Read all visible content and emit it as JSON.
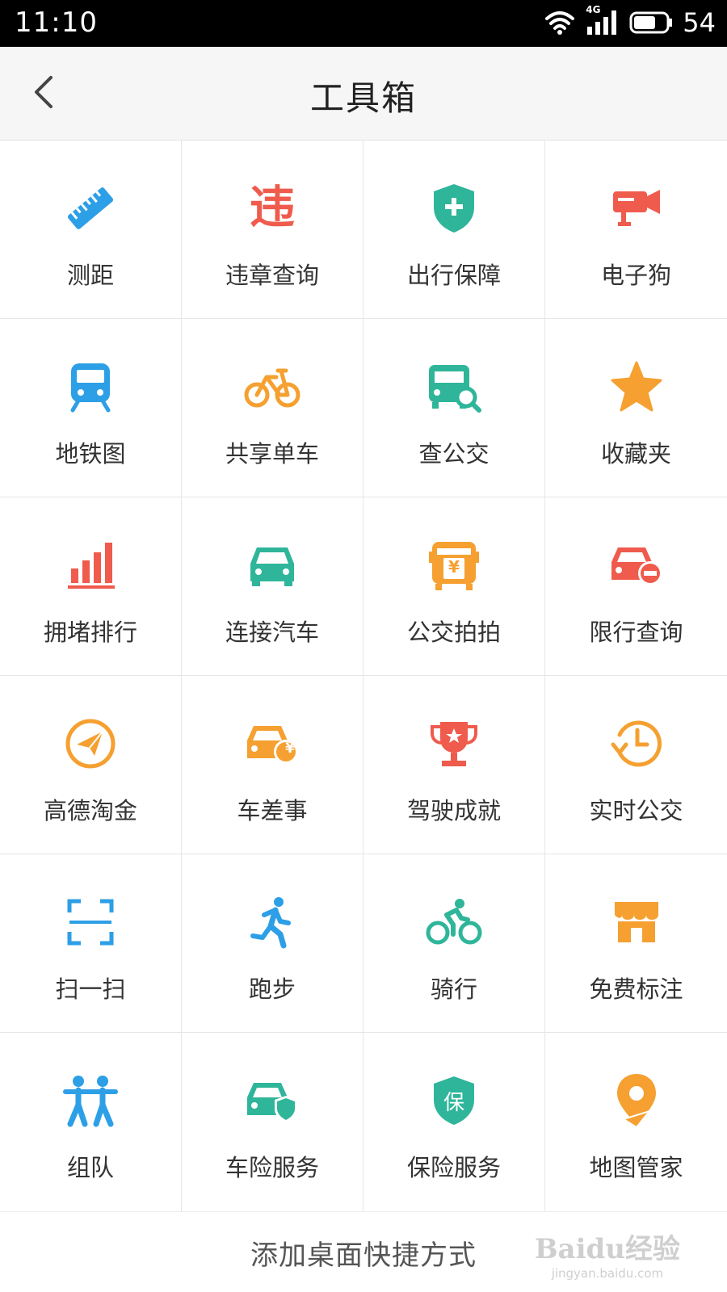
{
  "status_bar": {
    "time": "11:10",
    "network_label": "4G",
    "battery_level": "54",
    "icons": [
      "wifi-icon",
      "signal-icon",
      "battery-icon"
    ]
  },
  "header": {
    "title": "工具箱",
    "back_icon": "chevron-left-icon"
  },
  "tools": [
    {
      "label": "测距",
      "icon": "ruler-icon",
      "color": "#2d9fe6"
    },
    {
      "label": "违章查询",
      "icon": "violation-icon",
      "color": "#ef5b4c"
    },
    {
      "label": "出行保障",
      "icon": "shield-plus-icon",
      "color": "#2fb59a"
    },
    {
      "label": "电子狗",
      "icon": "camera-icon",
      "color": "#ef5b4c"
    },
    {
      "label": "地铁图",
      "icon": "subway-icon",
      "color": "#2d9fe6"
    },
    {
      "label": "共享单车",
      "icon": "bike-icon",
      "color": "#f5a030"
    },
    {
      "label": "查公交",
      "icon": "bus-search-icon",
      "color": "#2fb59a"
    },
    {
      "label": "收藏夹",
      "icon": "star-icon",
      "color": "#f5a030"
    },
    {
      "label": "拥堵排行",
      "icon": "bar-chart-icon",
      "color": "#ef5b4c"
    },
    {
      "label": "连接汽车",
      "icon": "car-icon",
      "color": "#2fb59a"
    },
    {
      "label": "公交拍拍",
      "icon": "bus-yuan-icon",
      "color": "#f5a030"
    },
    {
      "label": "限行查询",
      "icon": "car-limit-icon",
      "color": "#ef5b4c"
    },
    {
      "label": "高德淘金",
      "icon": "paper-plane-icon",
      "color": "#f5a030"
    },
    {
      "label": "车差事",
      "icon": "car-yuan-icon",
      "color": "#f5a030"
    },
    {
      "label": "驾驶成就",
      "icon": "trophy-icon",
      "color": "#ef5b4c"
    },
    {
      "label": "实时公交",
      "icon": "clock-icon",
      "color": "#f5a030"
    },
    {
      "label": "扫一扫",
      "icon": "scan-icon",
      "color": "#2d9fe6"
    },
    {
      "label": "跑步",
      "icon": "runner-icon",
      "color": "#2d9fe6"
    },
    {
      "label": "骑行",
      "icon": "cyclist-icon",
      "color": "#2fb59a"
    },
    {
      "label": "免费标注",
      "icon": "shop-icon",
      "color": "#f5a030"
    },
    {
      "label": "组队",
      "icon": "team-icon",
      "color": "#2d9fe6"
    },
    {
      "label": "车险服务",
      "icon": "car-shield-icon",
      "color": "#2fb59a"
    },
    {
      "label": "保险服务",
      "icon": "shield-bao-icon",
      "color": "#2fb59a"
    },
    {
      "label": "地图管家",
      "icon": "map-pin-icon",
      "color": "#f5a030"
    }
  ],
  "icon_text": {
    "violation": "违",
    "yuan": "¥",
    "bao": "保"
  },
  "footer": {
    "add_shortcut": "添加桌面快捷方式",
    "watermark_main": "Baidu经验",
    "watermark_sub": "jingyan.baidu.com"
  }
}
